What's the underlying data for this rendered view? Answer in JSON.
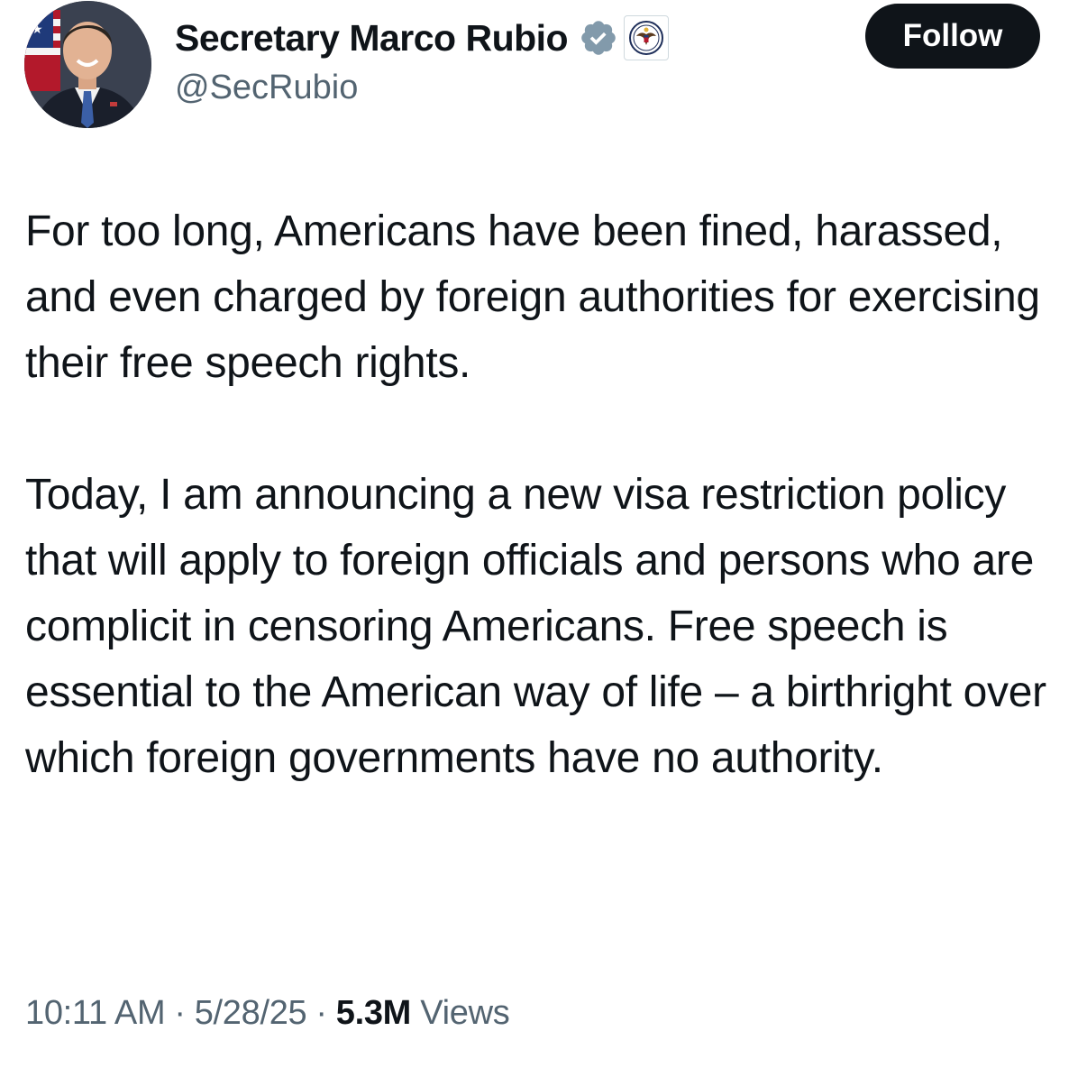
{
  "author": {
    "display_name": "Secretary Marco Rubio",
    "handle": "@SecRubio",
    "avatar_icon": "profile-photo",
    "verified_icon": "verified-badge-icon",
    "affiliation_icon": "state-department-seal-icon"
  },
  "follow_label": "Follow",
  "tweet": {
    "paragraphs": [
      "For too long, Americans have been fined, harassed, and even charged by foreign authorities for exercising their free speech rights.",
      "Today, I am announcing a new visa restriction policy that will apply to foreign officials and persons who are complicit in censoring Americans. Free speech is essential to the American way of life – a birthright over which foreign governments have no authority."
    ]
  },
  "meta": {
    "time": "10:11 AM",
    "date": "5/28/25",
    "separator": "·",
    "views_count": "5.3M",
    "views_label": "Views"
  },
  "colors": {
    "text_primary": "#0f1419",
    "text_secondary": "#536471",
    "follow_bg": "#0f1419",
    "verified_badge": "#829aab"
  }
}
